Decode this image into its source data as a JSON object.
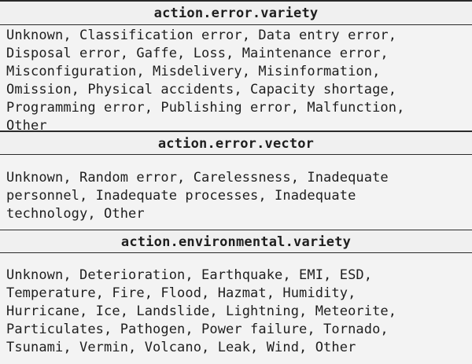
{
  "sections": [
    {
      "header": "action.error.variety",
      "text": "Unknown, Classification error, Data entry error,\nDisposal error, Gaffe, Loss, Maintenance error,\nMisconfiguration, Misdelivery, Misinformation,\nOmission, Physical accidents, Capacity shortage,\nProgramming error, Publishing error, Malfunction,\nOther"
    },
    {
      "header": "action.error.vector",
      "text": "Unknown, Random error, Carelessness, Inadequate\npersonnel, Inadequate processes, Inadequate\ntechnology, Other"
    },
    {
      "header": "action.environmental.variety",
      "text": "Unknown, Deterioration, Earthquake, EMI, ESD,\nTemperature, Fire, Flood, Hazmat, Humidity,\nHurricane, Ice, Landslide, Lightning, Meteorite,\nParticulates, Pathogen, Power failure, Tornado,\nTsunami, Vermin, Volcano, Leak, Wind, Other"
    }
  ]
}
